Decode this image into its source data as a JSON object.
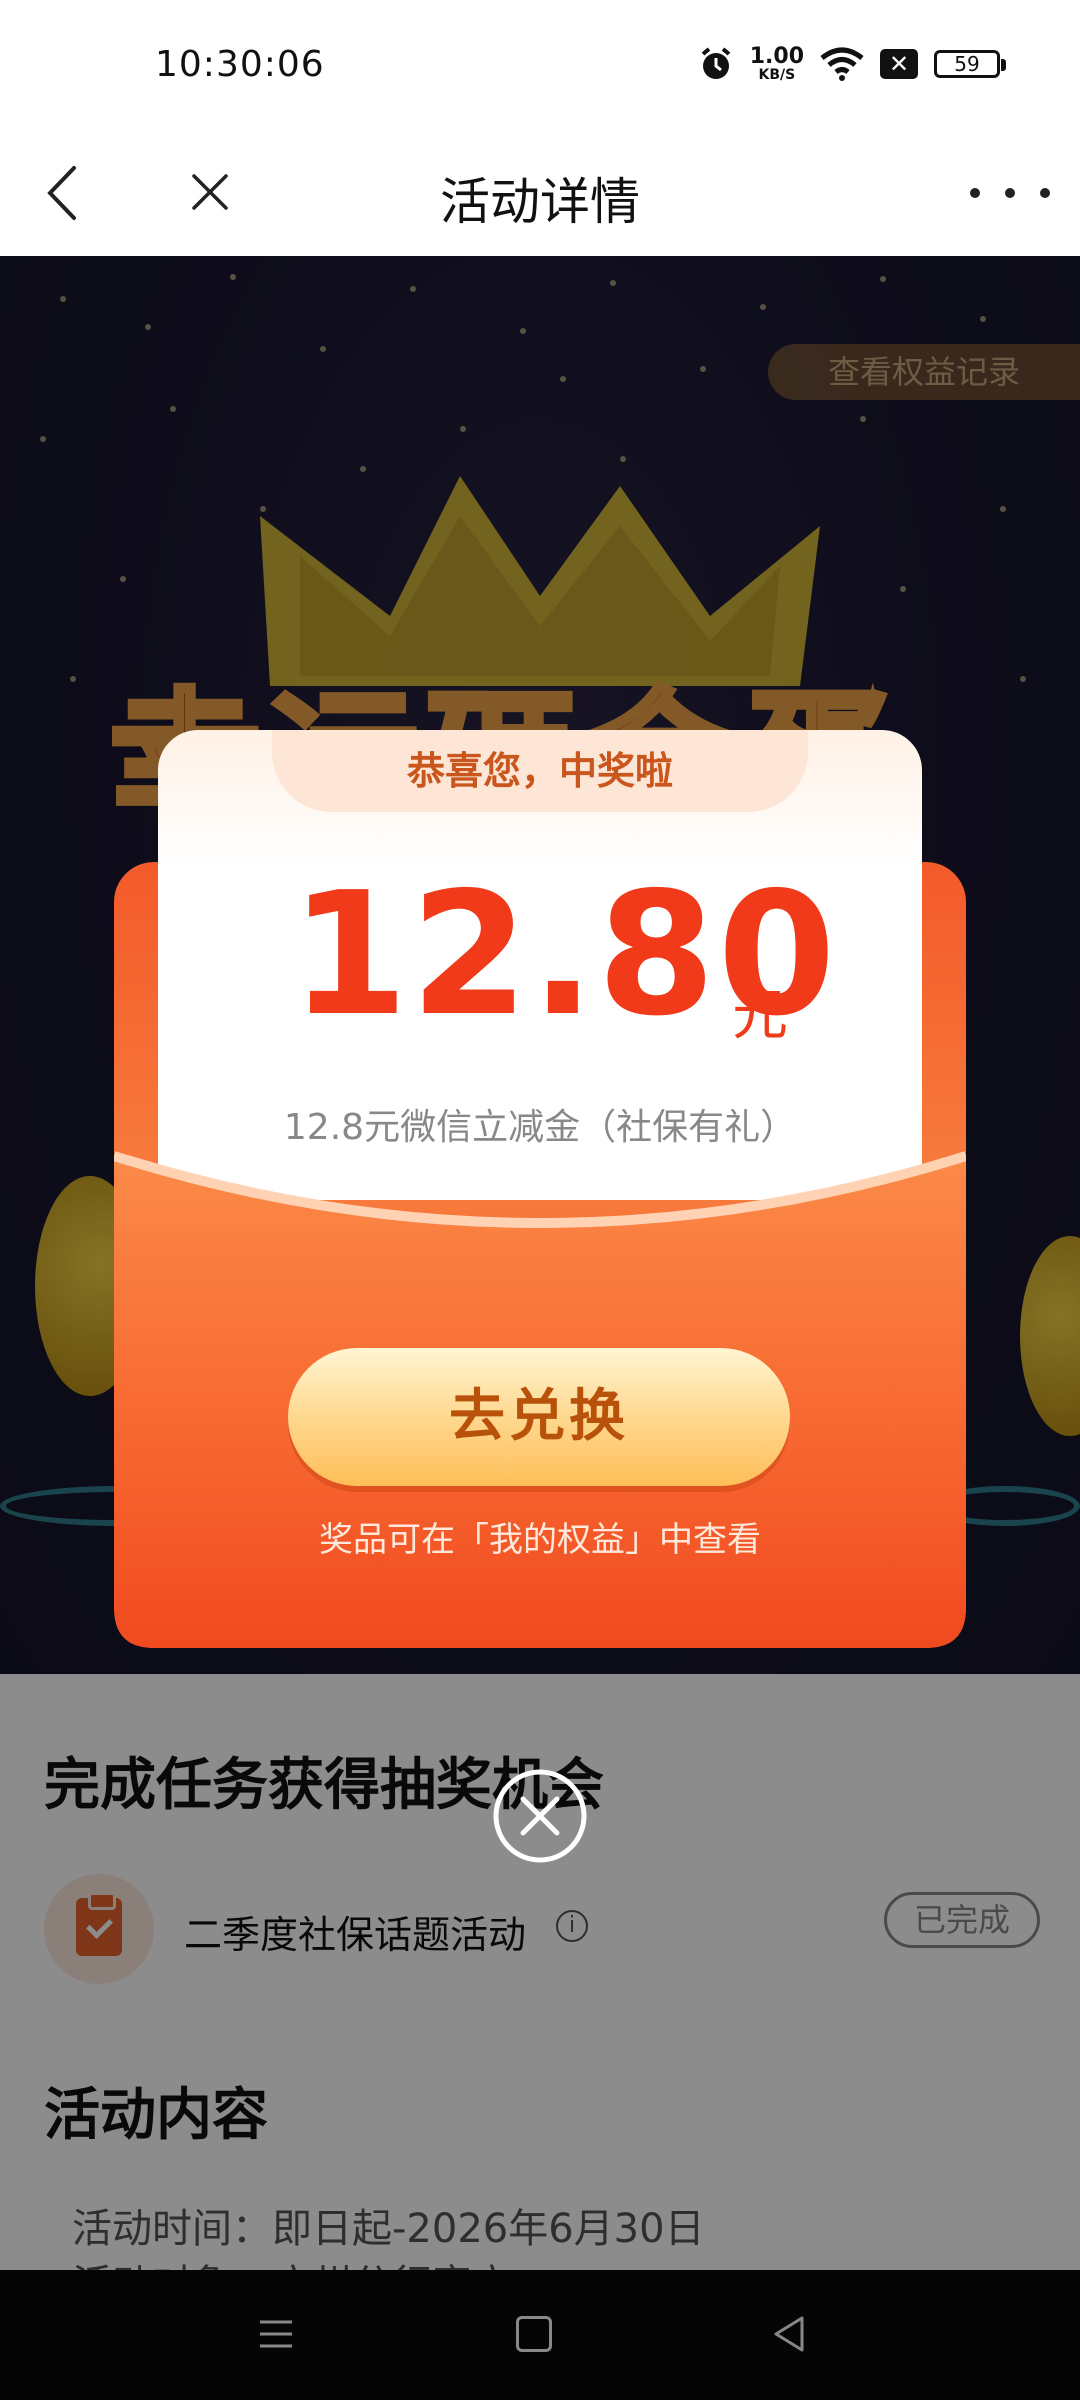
{
  "status_bar": {
    "time": "10:30:06",
    "net_speed_value": "1.00",
    "net_speed_unit": "KB/S",
    "battery": "59",
    "icons": [
      "alarm-icon",
      "wifi-icon",
      "close-box-icon",
      "battery-icon"
    ]
  },
  "nav": {
    "title": "活动详情",
    "icons": [
      "back-icon",
      "close-icon",
      "more-icon"
    ]
  },
  "banner": {
    "records_button": "查看权益记录",
    "title": "幸运砸金蛋"
  },
  "modal": {
    "congrats": "恭喜您，中奖啦",
    "amount": "12.80",
    "unit": "元",
    "description": "12.8元微信立减金（社保有礼）",
    "redeem_button": "去兑换",
    "note": "奖品可在「我的权益」中查看"
  },
  "content": {
    "task_section_title": "完成任务获得抽奖机会",
    "task": {
      "name": "二季度社保话题活动",
      "status": "已完成"
    },
    "activity_section_title": "活动内容",
    "details": [
      "活动时间：即日起-2026年6月30日",
      "活动对象：广州分行客户"
    ]
  },
  "colors": {
    "accent_red": "#f03a1a",
    "envelope_orange": "#f65a2a",
    "button_gold": "#ffd890"
  }
}
